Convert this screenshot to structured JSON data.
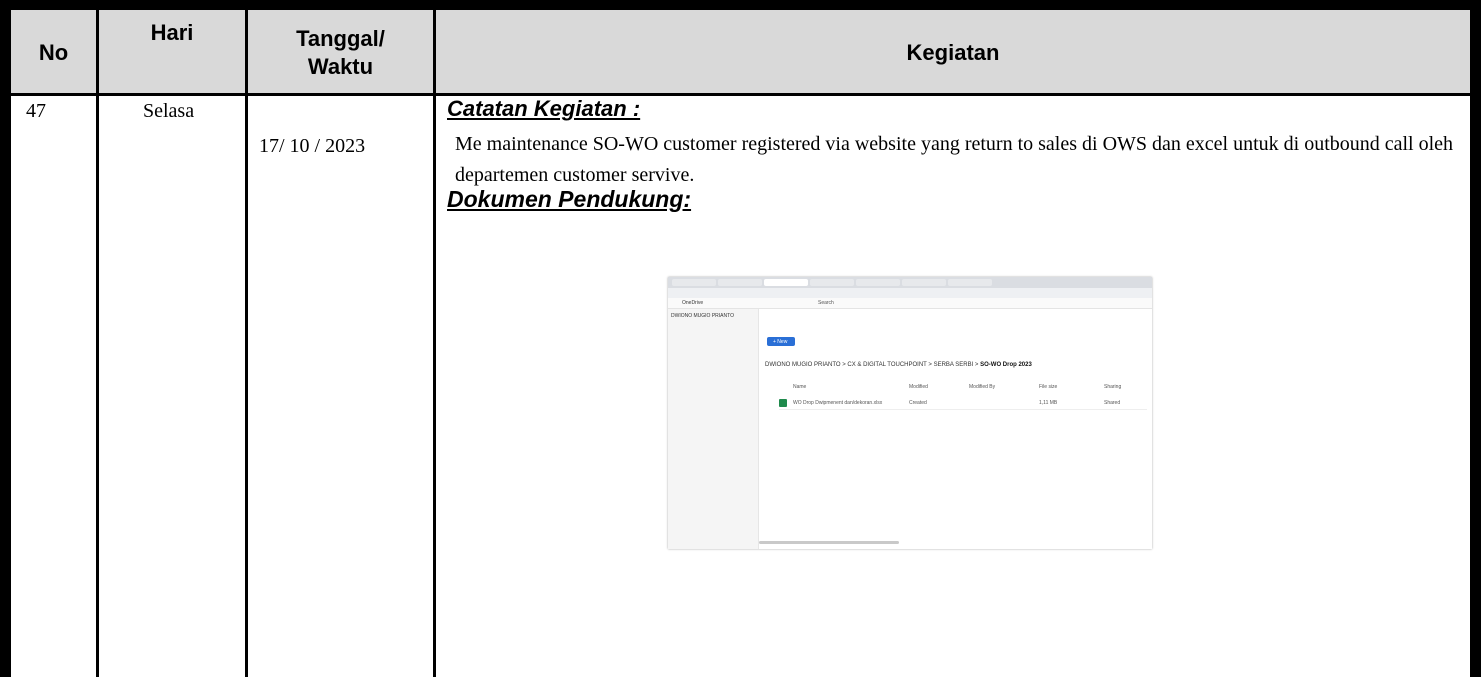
{
  "table": {
    "headers": {
      "no": "No",
      "hari": "Hari",
      "tanggal_line1": "Tanggal/",
      "tanggal_line2": "Waktu",
      "kegiatan": "Kegiatan"
    },
    "row": {
      "no": "47",
      "hari": "Selasa",
      "tanggal": "17/ 10 / 2023",
      "catatan_title": "Catatan Kegiatan :",
      "catatan_body": "Me maintenance SO-WO customer registered via website yang return to sales di OWS dan excel untuk di outbound call oleh departemen customer servive.",
      "dokumen_title": "Dokumen Pendukung:"
    }
  },
  "screenshot": {
    "app_name": "OneDrive",
    "search": "Search",
    "sidebar_user": "DWIONO MUGIO PRIANTO",
    "new_label": "+ New",
    "breadcrumb_prefix": "DWIONO MUGIO PRIANTO > CX & DIGITAL TOUCHPOINT > SERBA SERBI >",
    "breadcrumb_current": "SO-WO Drop 2023",
    "col_name": "Name",
    "col_modified": "Modified",
    "col_modified_by": "Modified By",
    "col_file_size": "File size",
    "col_sharing": "Sharing",
    "file_name": "WO Drop Dwipmenent dan/dekoran.xlsx",
    "file_modified": "Created",
    "file_size": "1,11 MB",
    "file_sharing": "Shared",
    "colors": {
      "excel_green": "#1f8a4c",
      "new_button_blue": "#2a6fd6"
    }
  }
}
